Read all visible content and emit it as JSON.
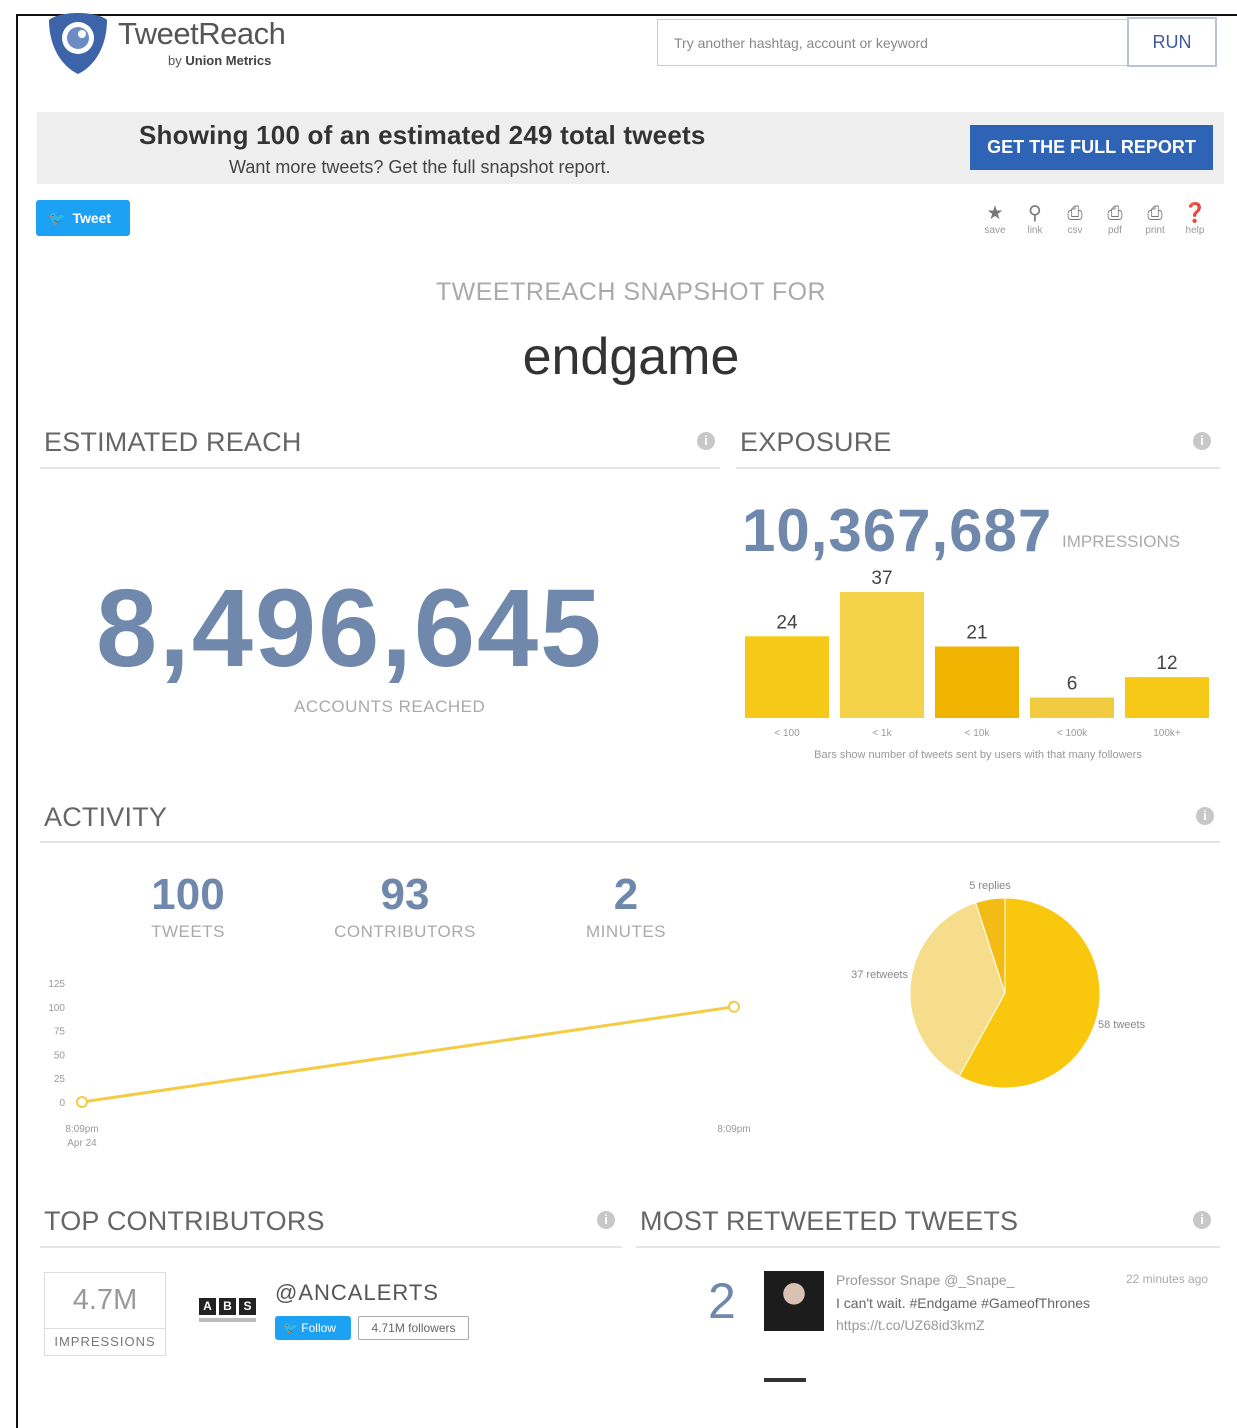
{
  "brand": {
    "name": "TweetReach",
    "by": "by",
    "company": "Union Metrics"
  },
  "search": {
    "placeholder": "Try another hashtag, account or keyword",
    "run_label": "RUN"
  },
  "banner": {
    "title": "Showing 100 of an estimated 249 total tweets",
    "subtitle": "Want more tweets? Get the full snapshot report.",
    "cta": "GET THE FULL REPORT"
  },
  "tweet_button": "Tweet",
  "tools": [
    {
      "icon": "star-icon",
      "glyph": "★",
      "label": "save"
    },
    {
      "icon": "link-icon",
      "glyph": "🔗",
      "label": "link"
    },
    {
      "icon": "csv-download-icon",
      "glyph": "⎙",
      "label": "csv"
    },
    {
      "icon": "pdf-download-icon",
      "glyph": "⎙",
      "label": "pdf"
    },
    {
      "icon": "print-icon",
      "glyph": "⎙",
      "label": "print"
    },
    {
      "icon": "help-icon",
      "glyph": "?",
      "label": "help"
    }
  ],
  "snapshot": {
    "heading": "TWEETREACH SNAPSHOT FOR",
    "term": "endgame"
  },
  "estimated_reach": {
    "title": "ESTIMATED REACH",
    "value": "8,496,645",
    "label": "ACCOUNTS REACHED"
  },
  "exposure": {
    "title": "EXPOSURE",
    "value": "10,367,687",
    "label": "IMPRESSIONS",
    "note": "Bars show number of tweets sent by users with that many followers"
  },
  "activity": {
    "title": "ACTIVITY",
    "stats": [
      {
        "value": "100",
        "label": "TWEETS"
      },
      {
        "value": "93",
        "label": "CONTRIBUTORS"
      },
      {
        "value": "2",
        "label": "MINUTES"
      }
    ]
  },
  "chart_data": [
    {
      "type": "bar",
      "categories": [
        "< 100",
        "< 1k",
        "< 10k",
        "< 100k",
        "100k+"
      ],
      "values": [
        24,
        37,
        21,
        6,
        12
      ],
      "colors": [
        "#f6c918",
        "#f4d34a",
        "#f0b400",
        "#f2cc40",
        "#f6c918"
      ],
      "xlabel": "",
      "ylabel": "",
      "ylim": [
        0,
        37
      ]
    },
    {
      "type": "line",
      "x": [
        "8:09pm Apr 24",
        "8:09pm"
      ],
      "series": [
        {
          "values": [
            0,
            100
          ]
        }
      ],
      "ylim": [
        0,
        125
      ],
      "yticks": [
        "0",
        "25",
        "50",
        "75",
        "100",
        "125"
      ],
      "xticks": [
        [
          "8:09pm",
          "Apr 24"
        ],
        [
          "8:09pm"
        ]
      ],
      "color": "#f3cc43"
    },
    {
      "type": "pie",
      "slices": [
        {
          "label": "58 tweets",
          "value": 58,
          "color": "#f9c80e"
        },
        {
          "label": "37 retweets",
          "value": 37,
          "color": "#f6dd8c"
        },
        {
          "label": "5 replies",
          "value": 5,
          "color": "#f2bc14"
        }
      ]
    }
  ],
  "top_contributors": {
    "title": "TOP CONTRIBUTORS",
    "impressions": "4.7M",
    "impressions_label": "IMPRESSIONS",
    "handle": "@ANCALERTS",
    "follow_label": "Follow",
    "followers": "4.71M followers"
  },
  "most_retweeted": {
    "title": "MOST RETWEETED TWEETS",
    "count": "2",
    "user": "Professor Snape @_Snape_",
    "time": "22 minutes ago",
    "text": "I can't wait. #Endgame #GameofThrones",
    "link": "https://t.co/UZ68id3kmZ"
  }
}
